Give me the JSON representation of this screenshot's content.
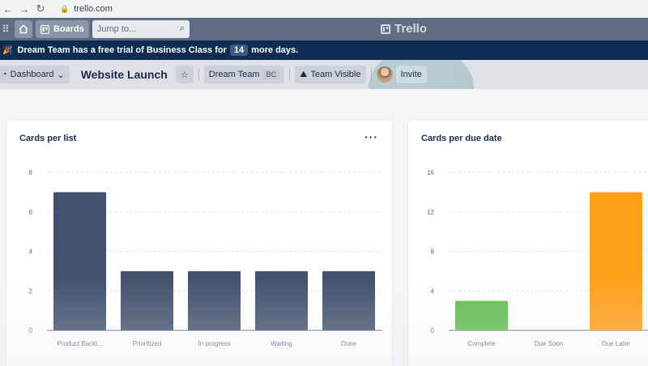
{
  "browser": {
    "url": "trello.com"
  },
  "header": {
    "boards_label": "Boards",
    "search_placeholder": "Jump to...",
    "logo_text": "Trello"
  },
  "banner": {
    "prefix": "Dream Team has a free trial of Business Class for",
    "days": "14",
    "suffix": "more days."
  },
  "board": {
    "view_label": "Dashboard",
    "title": "Website Launch",
    "team_label": "Dream Team",
    "team_badge": "BC",
    "visibility_label": "Team Visible",
    "invite_label": "Invite"
  },
  "chart_data": [
    {
      "type": "bar",
      "title": "Cards per list",
      "categories": [
        "Product Backl...",
        "Prioritized",
        "In progress",
        "Waiting",
        "Done"
      ],
      "values": [
        7,
        3,
        3,
        3,
        3
      ],
      "colors": [
        "#42526e",
        "#42526e",
        "#42526e",
        "#42526e",
        "#42526e"
      ],
      "ylim": [
        0,
        8
      ],
      "yticks": [
        0,
        2,
        4,
        6,
        8
      ],
      "grid": true
    },
    {
      "type": "bar",
      "title": "Cards per due date",
      "categories": [
        "Complete",
        "Due Soon",
        "Due Later"
      ],
      "values": [
        3,
        0,
        14
      ],
      "colors": [
        "#61bd4f",
        "#f2d600",
        "#ff9f1a"
      ],
      "ylim": [
        0,
        16
      ],
      "yticks": [
        0,
        4,
        8,
        12,
        16
      ],
      "grid": true
    }
  ]
}
